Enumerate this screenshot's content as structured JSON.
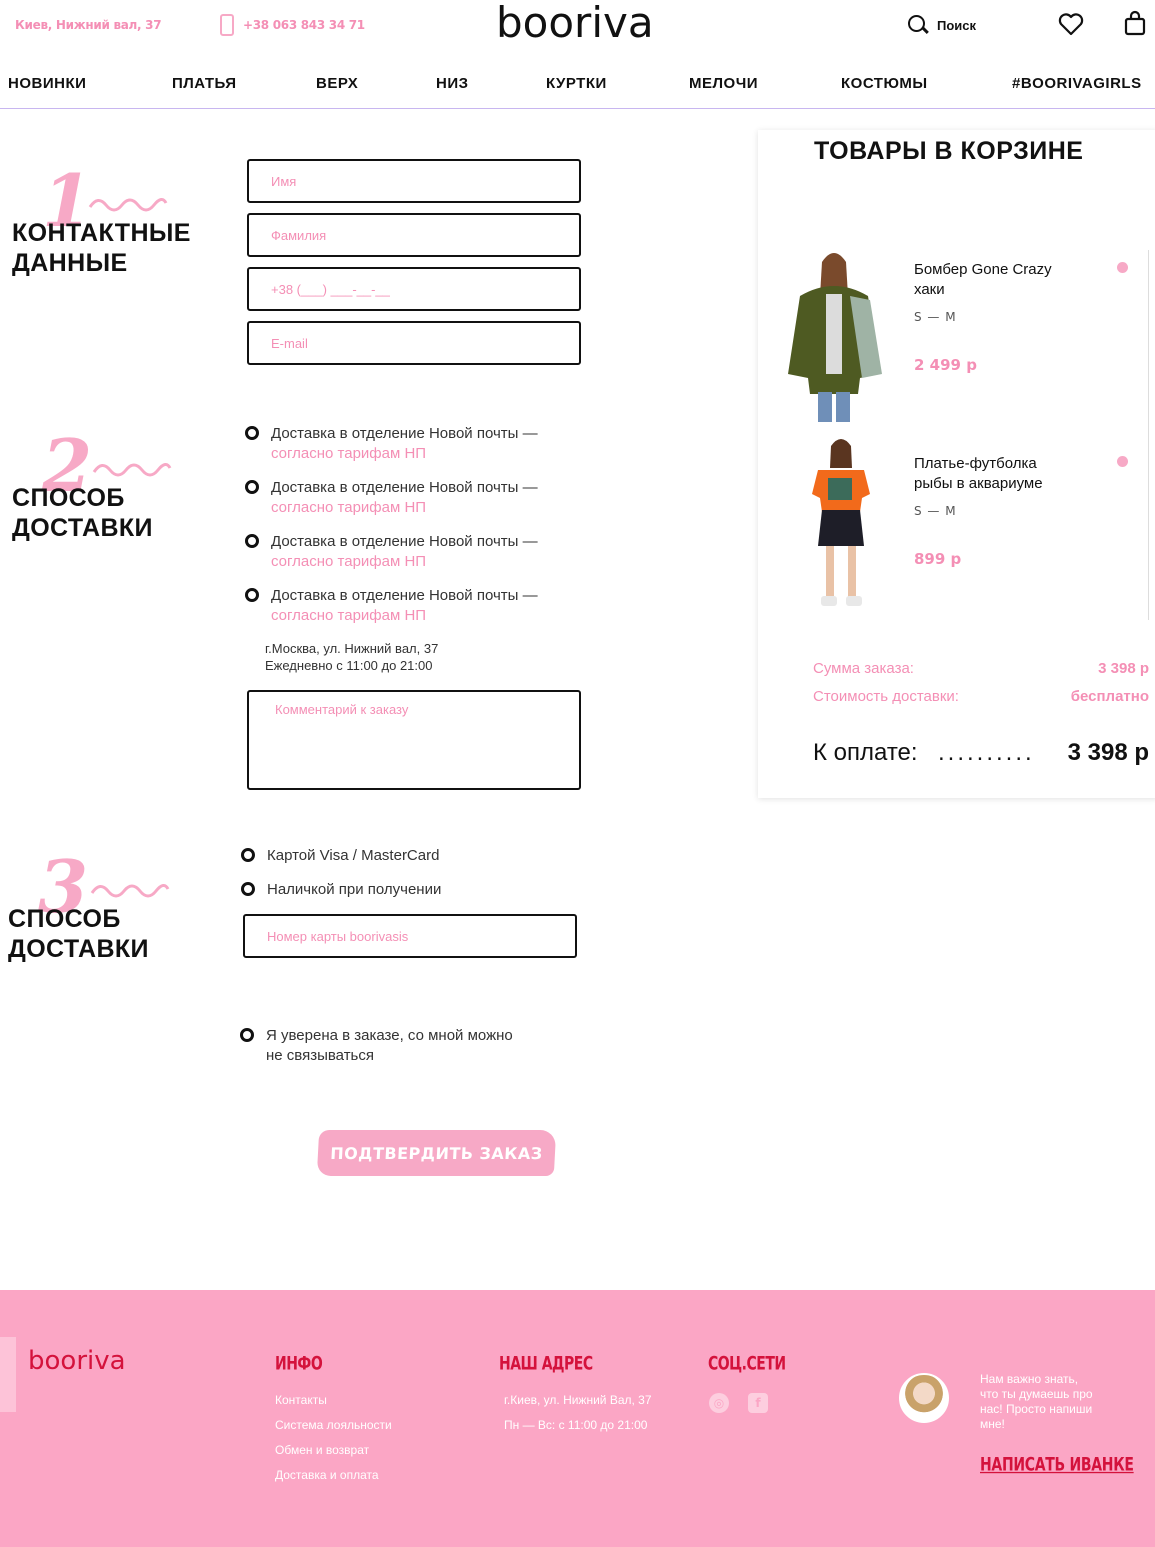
{
  "header": {
    "address": "Киев, Нижний вал, 37",
    "phone": "+38 063 843 34 71",
    "logo": "booriva",
    "search_label": "Поиск",
    "nav": [
      "НОВИНКИ",
      "ПЛАТЬЯ",
      "ВЕРХ",
      "НИЗ",
      "КУРТКИ",
      "МЕЛОЧИ",
      "КОСТЮМЫ",
      "#BOORIVAGIRLS"
    ]
  },
  "contact": {
    "number": "1",
    "title_line1": "КОНТАКТНЫЕ",
    "title_line2": "ДАННЫЕ",
    "placeholders": {
      "name": "Имя",
      "surname": "Фамилия",
      "phone": "+38 (___) ___-__-__",
      "email": "E-mail"
    }
  },
  "delivery": {
    "number": "2",
    "title_line1": "СПОСОБ",
    "title_line2": "ДОСТАВКИ",
    "options": [
      {
        "label": "Доставка в отделение Новой почты —",
        "note": "согласно тарифам НП"
      },
      {
        "label": "Доставка в отделение Новой почты —",
        "note": "согласно тарифам НП"
      },
      {
        "label": "Доставка в отделение Новой почты —",
        "note": "согласно тарифам НП"
      },
      {
        "label": "Доставка в отделение Новой почты —",
        "note": "согласно тарифам НП"
      }
    ],
    "pickup_address": "г.Москва, ул. Нижний вал, 37",
    "pickup_hours": "Ежедневно с 11:00 до 21:00",
    "comment_placeholder": "Комментарий к заказу"
  },
  "payment": {
    "number": "3",
    "title_line1": "СПОСОБ",
    "title_line2": "ДОСТАВКИ",
    "options": [
      "Картой Visa / MasterCard",
      "Наличкой при получении"
    ],
    "card_placeholder": "Номер карты  boorivasis",
    "confirm_no_call_line1": "Я уверена в заказе, со мной можно",
    "confirm_no_call_line2": "не связываться",
    "confirm_button": "ПОДТВЕРДИТЬ ЗАКАЗ"
  },
  "cart": {
    "title": "ТОВАРЫ В КОРЗИНЕ",
    "items": [
      {
        "name_line1": "Бомбер Gone Crazy",
        "name_line2": "хаки",
        "size": "S — M",
        "price": "2 499 р"
      },
      {
        "name_line1": "Платье-футболка",
        "name_line2": "рыбы в аквариуме",
        "size": "S — M",
        "price": "899 р"
      }
    ],
    "order_sum_label": "Сумма заказа:",
    "order_sum": "3 398 р",
    "delivery_cost_label": "Стоимость доставки:",
    "delivery_cost": "бесплатно",
    "total_label": "К оплате:",
    "total_dots": "..........",
    "total": "3 398 р"
  },
  "footer": {
    "logo": "booriva",
    "info_head": "ИНФО",
    "info_links": [
      "Контакты",
      "Система лояльности",
      "Обмен и возврат",
      "Доставка и оплата"
    ],
    "address_head": "НАШ АДРЕС",
    "address_lines": [
      "г.Киев, ул. Нижний Вал, 37",
      "Пн — Вс: с 11:00 до 21:00"
    ],
    "social_head": "СОЦ.СЕТИ",
    "social_icons": [
      "instagram-icon",
      "facebook-icon"
    ],
    "quote_lines": [
      "Нам важно знать,",
      "что ты думаешь про",
      "нас! Просто напиши",
      "мне!"
    ],
    "cta": "НАПИСАТЬ ИВАНКЕ"
  },
  "colors": {
    "accent_pink": "#f48fb5",
    "footer_bg": "#fba6c5",
    "footer_red": "#d4123c",
    "nav_divider": "#c8b6f0"
  }
}
